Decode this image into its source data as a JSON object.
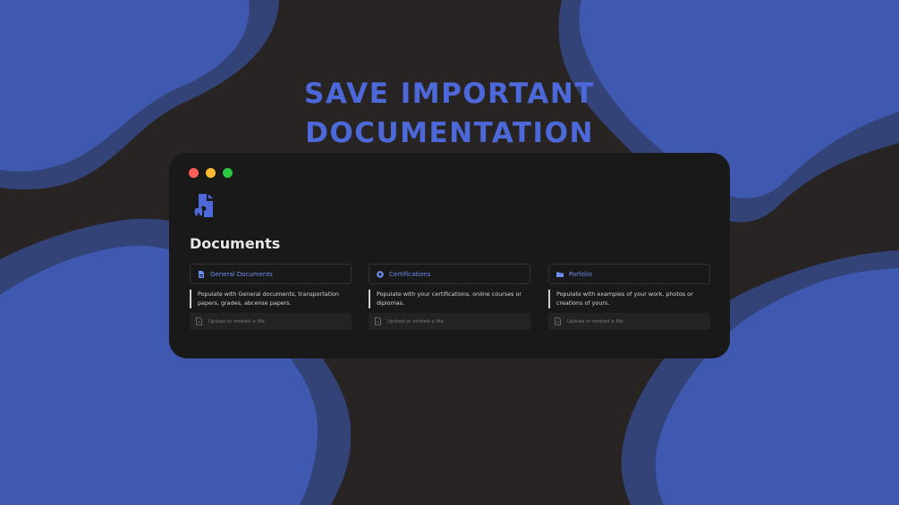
{
  "headline": {
    "line1": "SAVE IMPORTANT",
    "line2": "DOCUMENTATION"
  },
  "window": {
    "controls": [
      "close",
      "minimize",
      "maximize"
    ],
    "page_icon": "document-puzzle-icon",
    "title": "Documents"
  },
  "cards": [
    {
      "icon": "document-icon",
      "title": "General Documents",
      "description": "Populate with General documents, transportation papers, grades, abcense papers.",
      "upload_label": "Upload or embed a file"
    },
    {
      "icon": "badge-icon",
      "title": "Certifications",
      "description": "Populate with your certifications, online courses or diplomas.",
      "upload_label": "Upload or embed a file"
    },
    {
      "icon": "folder-icon",
      "title": "Porfolio",
      "description": "Populate with examples of your work, photos or creations of yours.",
      "upload_label": "Upload or embed a file"
    }
  ],
  "colors": {
    "background": "#282423",
    "blob_light": "#3f59b0",
    "blob_dark": "#334377",
    "accent": "#4d68d8",
    "window": "#191919"
  }
}
